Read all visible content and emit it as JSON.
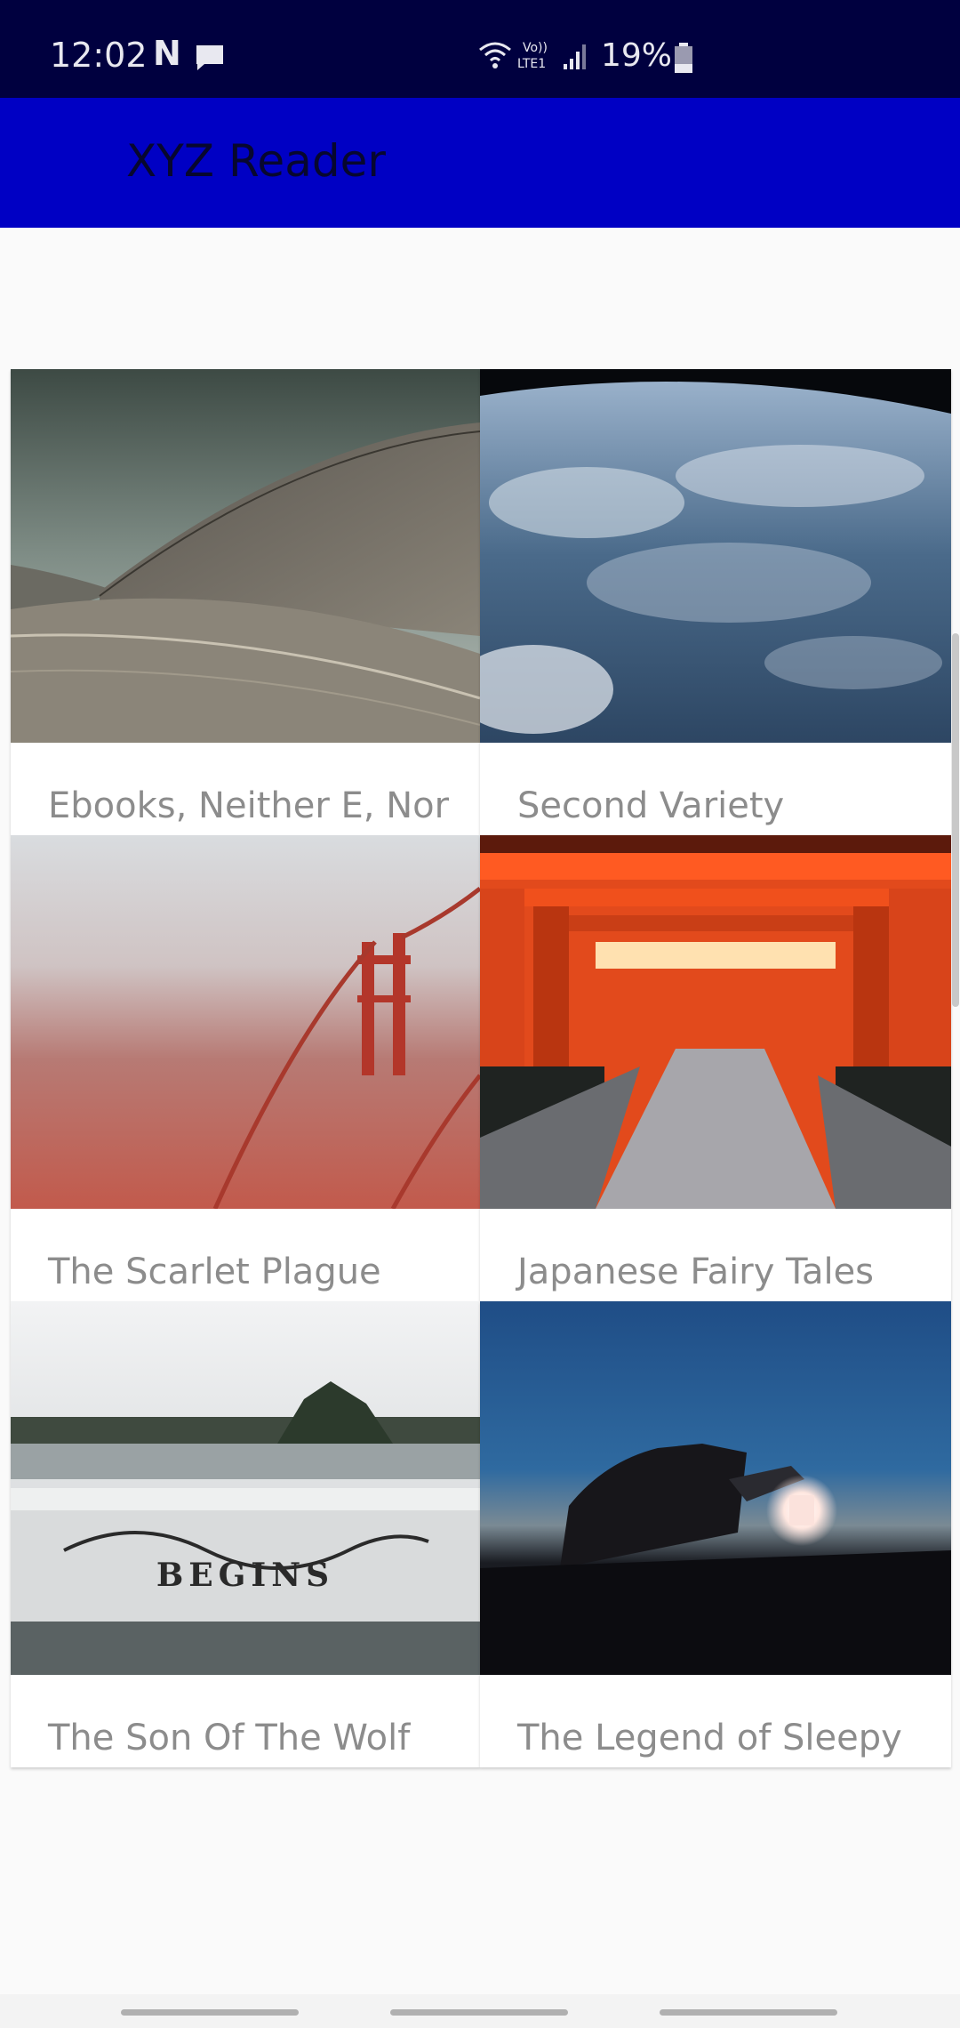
{
  "status_bar": {
    "time": "12:02",
    "notification_letter": "N",
    "icons": [
      "message-icon",
      "wifi-icon",
      "volte-icon",
      "cell-signal-icon",
      "battery-icon"
    ],
    "battery_percent": "19%"
  },
  "app_bar": {
    "title": "XYZ Reader",
    "color": "#0000c4"
  },
  "articles": [
    {
      "title": "Ebooks, Neither E, Nor"
    },
    {
      "title": "Second Variety"
    },
    {
      "title": "The Scarlet Plague"
    },
    {
      "title": "Japanese Fairy Tales"
    },
    {
      "title": "The Son Of The Wolf"
    },
    {
      "title": "The Legend of Sleepy"
    }
  ],
  "nav_bar": {
    "buttons": [
      "recent-apps-button",
      "home-button",
      "back-button"
    ]
  }
}
